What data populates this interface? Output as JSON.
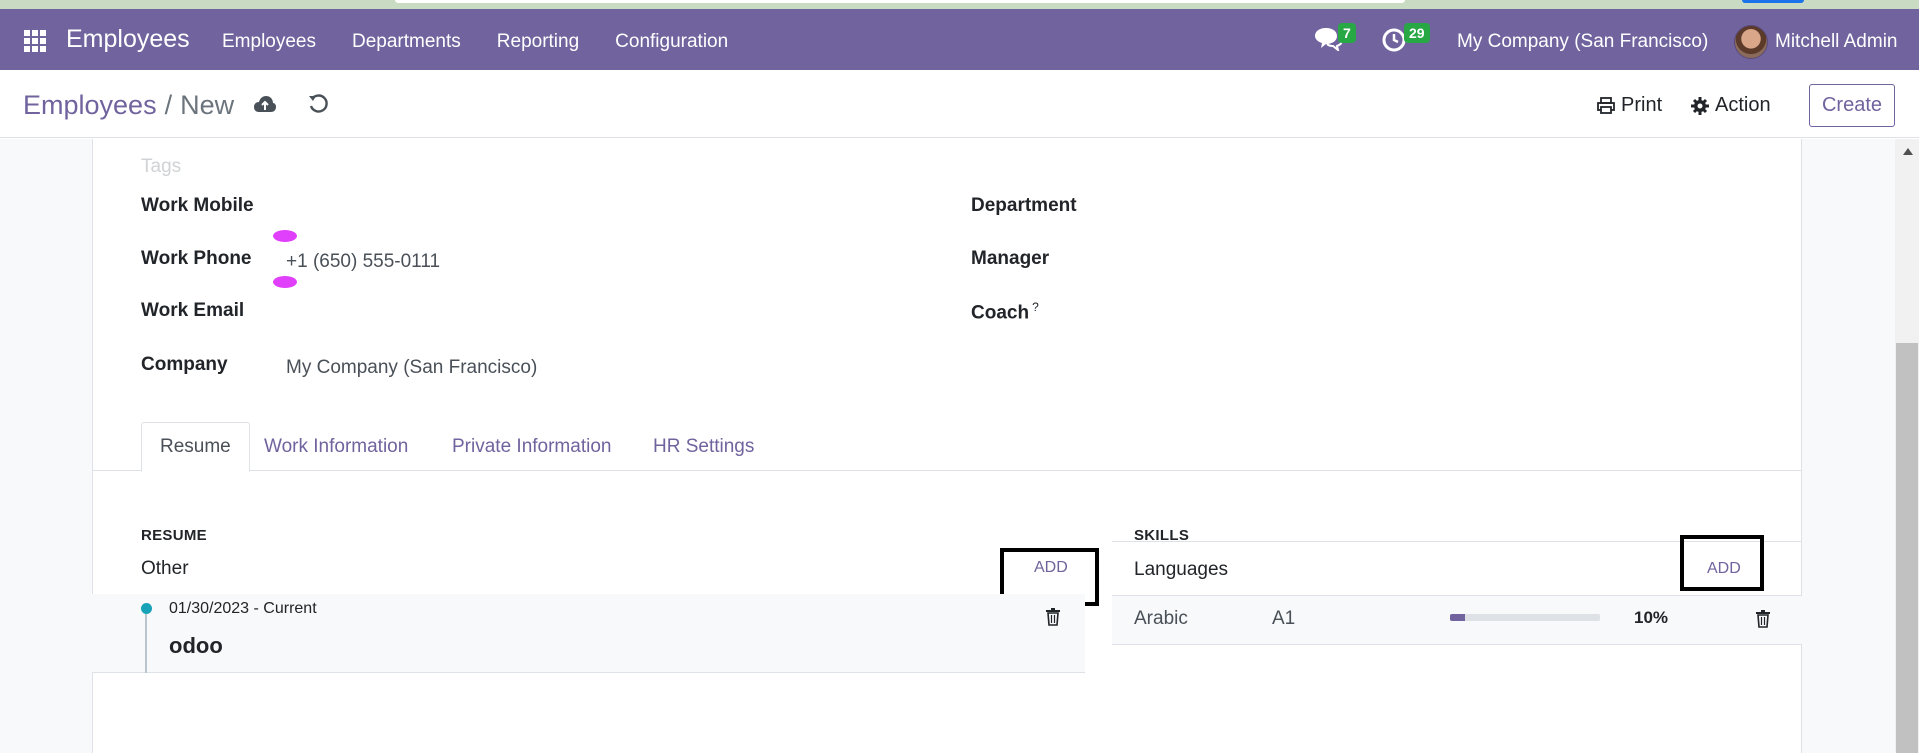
{
  "navbar": {
    "app_name": "Employees",
    "menu": [
      "Employees",
      "Departments",
      "Reporting",
      "Configuration"
    ],
    "messages_count": "7",
    "activities_count": "29",
    "company": "My Company (San Francisco)",
    "user": "Mitchell Admin",
    "accent_color": "#71639e"
  },
  "control": {
    "breadcrumb_parent": "Employees",
    "breadcrumb_sep": "/",
    "breadcrumb_current": "New",
    "print_label": "Print",
    "action_label": "Action",
    "create_label": "Create"
  },
  "form": {
    "tags_placeholder": "Tags",
    "work_mobile_label": "Work Mobile",
    "work_phone_label": "Work Phone",
    "work_phone_value": "+1 (650) 555-0111",
    "work_email_label": "Work Email",
    "company_label": "Company",
    "company_value": "My Company (San Francisco)",
    "department_label": "Department",
    "manager_label": "Manager",
    "coach_label": "Coach",
    "coach_help": "?"
  },
  "tabs": [
    "Resume",
    "Work Information",
    "Private Information",
    "HR Settings"
  ],
  "resume": {
    "section_title": "RESUME",
    "group_title": "Other",
    "add_label": "ADD",
    "lines": [
      {
        "date": "01/30/2023 - Current",
        "name": "odoo"
      }
    ]
  },
  "skills": {
    "section_title": "SKILLS",
    "group_title": "Languages",
    "add_label": "ADD",
    "rows": [
      {
        "name": "Arabic",
        "level": "A1",
        "progress": "10%",
        "progress_fraction": 0.1
      }
    ]
  }
}
